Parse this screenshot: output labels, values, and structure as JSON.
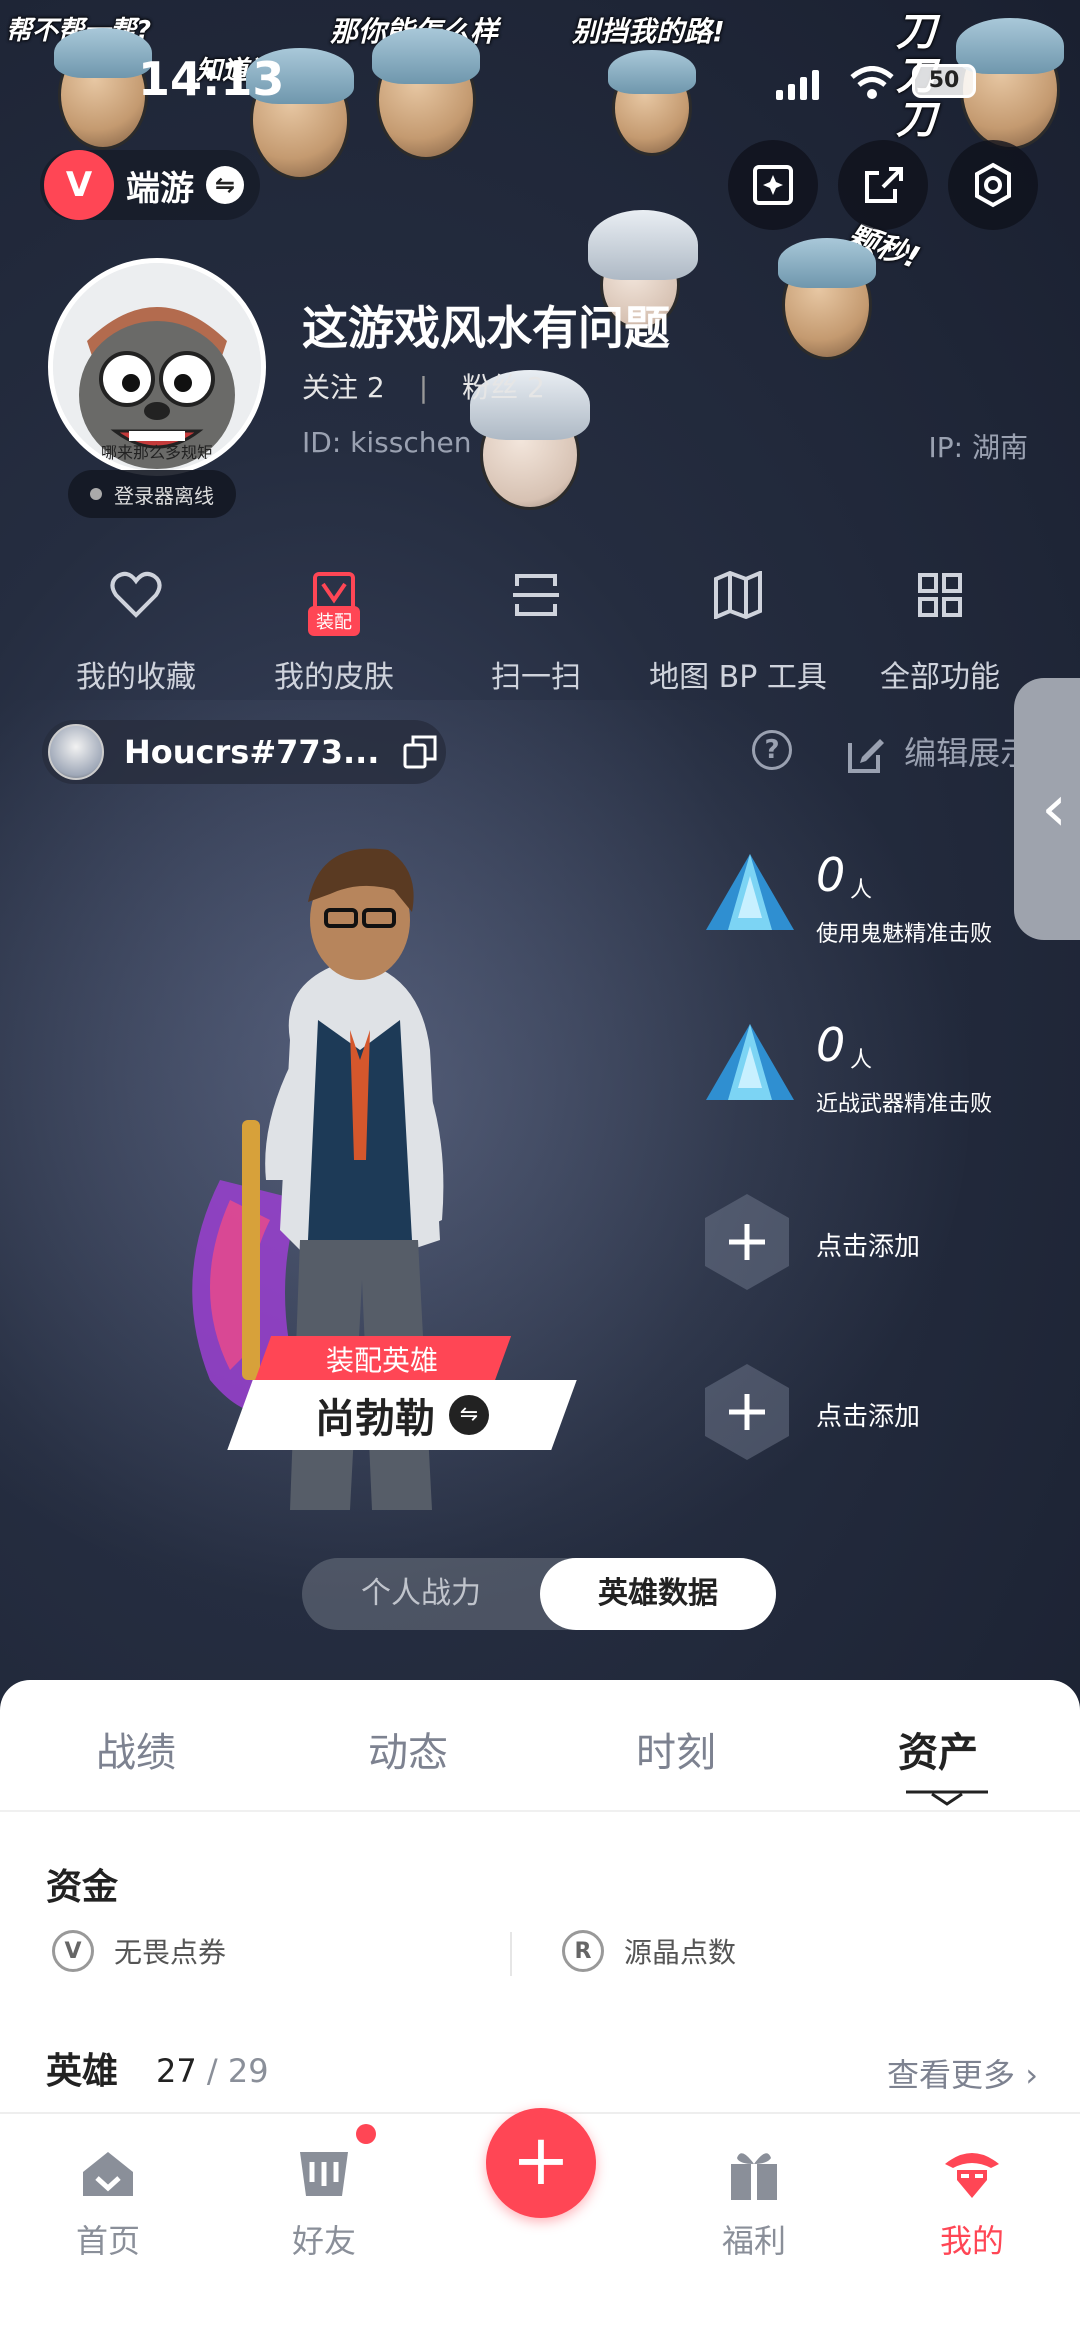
{
  "status_bar": {
    "time": "14:13",
    "battery": "50"
  },
  "stickers": [
    "帮不帮一帮?",
    "知道说!?",
    "那你能怎么样",
    "别挡我的路!",
    "刀刀刀",
    "颗秒!"
  ],
  "header": {
    "app_name": "端游",
    "app_logo": "V"
  },
  "profile": {
    "nickname": "这游戏风水有问题",
    "follow_label": "关注 2",
    "fans_label": "粉丝 2",
    "id_label": "ID: kisschen",
    "ip_label": "IP: 湖南",
    "online_status": "登录器离线",
    "avatar_caption": "哪来那么多规矩"
  },
  "quick_actions": [
    {
      "label": "我的收藏",
      "icon": "heart-icon"
    },
    {
      "label": "我的皮肤",
      "icon": "skin-icon",
      "badge": "装配"
    },
    {
      "label": "扫一扫",
      "icon": "scan-icon"
    },
    {
      "label": "地图 BP 工具",
      "icon": "map-icon"
    },
    {
      "label": "全部功能",
      "icon": "grid-icon"
    }
  ],
  "account": {
    "name": "Houcrs#773...",
    "help": "?",
    "edit_label": "编辑展示"
  },
  "hero": {
    "tag": "装配英雄",
    "name": "尚勃勒",
    "swap": "⇋"
  },
  "stats": [
    {
      "count": "0",
      "unit": "人",
      "label": "使用鬼魅精准击败"
    },
    {
      "count": "0",
      "unit": "人",
      "label": "近战武器精准击败"
    }
  ],
  "add_slots": [
    "点击添加",
    "点击添加"
  ],
  "toggle": {
    "left": "个人战力",
    "right": "英雄数据"
  },
  "tabs": [
    "战绩",
    "动态",
    "时刻",
    "资产"
  ],
  "funds": {
    "title": "资金",
    "currency_1": "无畏点券",
    "currency_2": "源晶点数",
    "icon_1": "V",
    "icon_2": "R"
  },
  "heroes": {
    "title": "英雄",
    "owned": "27",
    "slash": " / ",
    "total": "29",
    "more": "查看更多 ›"
  },
  "bottom_nav": [
    {
      "label": "首页",
      "icon": "home-icon"
    },
    {
      "label": "好友",
      "icon": "friends-icon"
    },
    {
      "label": "福利",
      "icon": "gift-icon"
    },
    {
      "label": "我的",
      "icon": "profile-icon"
    }
  ],
  "fab": "+",
  "colors": {
    "accent": "#ff4655",
    "background": "#1b2233",
    "sheet": "#ffffff"
  }
}
